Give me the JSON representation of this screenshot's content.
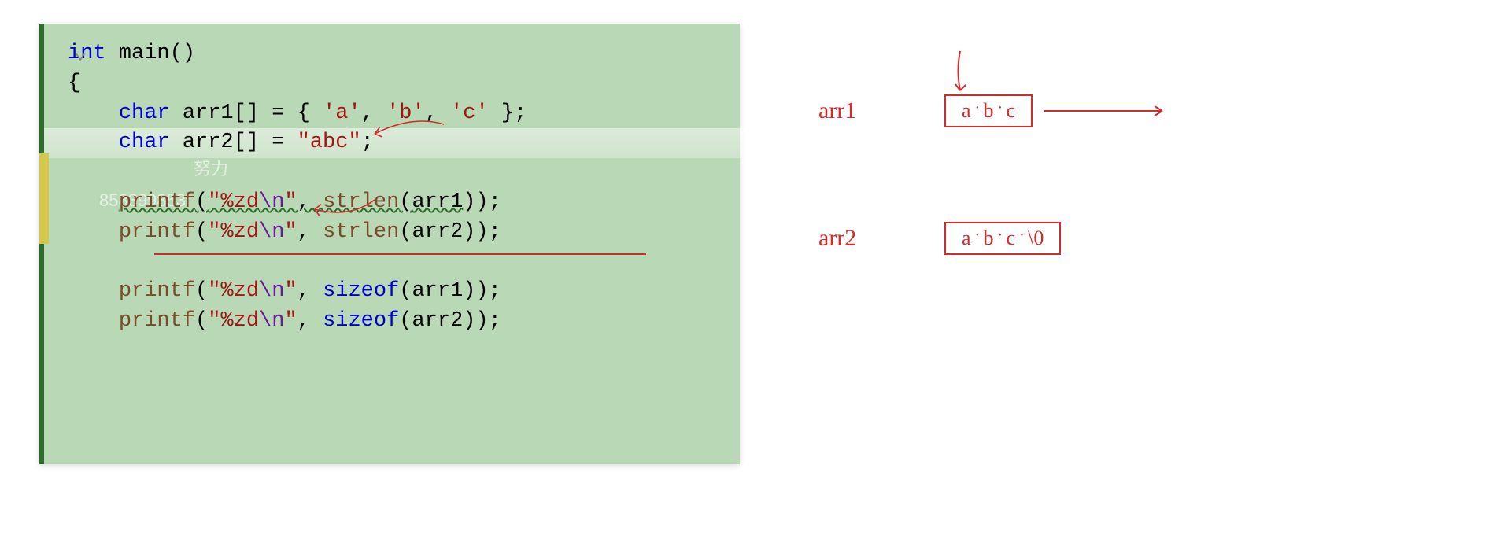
{
  "code": {
    "line1_kw": "int",
    "line1_func": " main",
    "line1_paren": "()",
    "line2": "{",
    "line3_indent": "    ",
    "line3_kw": "char",
    "line3_ident": " arr1[] ",
    "line3_eq": "= { ",
    "line3_c1": "'a'",
    "line3_comma1": ", ",
    "line3_c2": "'b'",
    "line3_comma2": ", ",
    "line3_c3": "'c'",
    "line3_end": " };",
    "line4_indent": "    ",
    "line4_kw": "char",
    "line4_ident": " arr2[] ",
    "line4_eq": "= ",
    "line4_str": "\"abc\"",
    "line4_end": ";",
    "line6_indent": "    ",
    "line6_func": "printf",
    "line6_open": "(",
    "line6_fmt1": "\"%zd",
    "line6_esc": "\\n",
    "line6_fmt2": "\"",
    "line6_comma": ", ",
    "line6_strlen": "strlen",
    "line6_arg_open": "(",
    "line6_arg": "arr1",
    "line6_close": "));",
    "line7_indent": "    ",
    "line7_func": "printf",
    "line7_open": "(",
    "line7_fmt1": "\"%zd",
    "line7_esc": "\\n",
    "line7_fmt2": "\"",
    "line7_comma": ", ",
    "line7_strlen": "strlen",
    "line7_arg_open": "(",
    "line7_arg": "arr2",
    "line7_close": "));",
    "line9_indent": "    ",
    "line9_func": "printf",
    "line9_open": "(",
    "line9_fmt1": "\"%zd",
    "line9_esc": "\\n",
    "line9_fmt2": "\"",
    "line9_comma": ", ",
    "line9_sizeof": "sizeof",
    "line9_arg": "(arr1));",
    "line10_indent": "    ",
    "line10_func": "printf",
    "line10_open": "(",
    "line10_fmt1": "\"%zd",
    "line10_esc": "\\n",
    "line10_fmt2": "\"",
    "line10_comma": ", ",
    "line10_sizeof": "sizeof",
    "line10_arg": "(arr2));",
    "watermark1": "努力",
    "watermark2": "858399853"
  },
  "diagram": {
    "arr1_label": "arr1",
    "arr1_cells": [
      "a",
      "b",
      "c"
    ],
    "arr2_label": "arr2",
    "arr2_cells": [
      "a",
      "b",
      "c",
      "\\0"
    ]
  }
}
